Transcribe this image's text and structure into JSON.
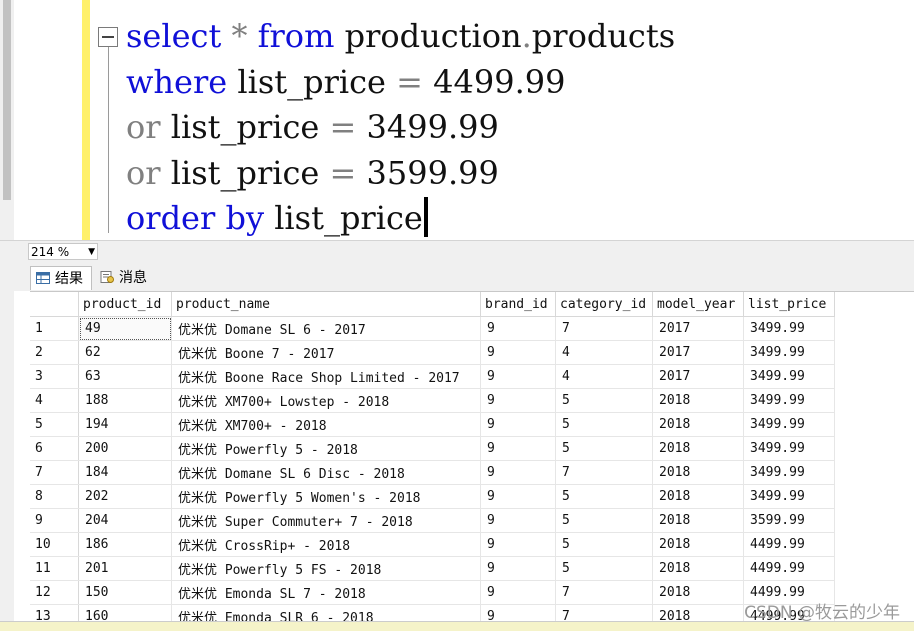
{
  "editor": {
    "lines": [
      {
        "parts": [
          [
            "kw-blue",
            "select"
          ],
          [
            "op-gray",
            " * "
          ],
          [
            "kw-blue",
            "from"
          ],
          [
            "plain",
            " production"
          ],
          [
            "op-gray",
            "."
          ],
          [
            "plain",
            "products"
          ]
        ]
      },
      {
        "parts": [
          [
            "kw-blue",
            "where"
          ],
          [
            "plain",
            " list_price "
          ],
          [
            "op-gray",
            "="
          ],
          [
            "plain",
            " 4499.99"
          ]
        ]
      },
      {
        "parts": [
          [
            "kw-gray",
            "or"
          ],
          [
            "plain",
            " list_price "
          ],
          [
            "op-gray",
            "="
          ],
          [
            "plain",
            " 3499.99"
          ]
        ]
      },
      {
        "parts": [
          [
            "kw-gray",
            "or"
          ],
          [
            "plain",
            " list_price "
          ],
          [
            "op-gray",
            "="
          ],
          [
            "plain",
            " 3599.99"
          ]
        ]
      },
      {
        "parts": [
          [
            "kw-blue",
            "order"
          ],
          [
            "plain",
            " "
          ],
          [
            "kw-blue",
            "by"
          ],
          [
            "plain",
            " list_price"
          ]
        ]
      }
    ]
  },
  "zoom": {
    "value": "214 %"
  },
  "tabs": {
    "results": "结果",
    "messages": "消息"
  },
  "grid": {
    "columns": [
      "product_id",
      "product_name",
      "brand_id",
      "category_id",
      "model_year",
      "list_price"
    ],
    "rows": [
      [
        "1",
        "49",
        "优米优 Domane SL 6 - 2017",
        "9",
        "7",
        "2017",
        "3499.99"
      ],
      [
        "2",
        "62",
        "优米优 Boone 7 - 2017",
        "9",
        "4",
        "2017",
        "3499.99"
      ],
      [
        "3",
        "63",
        "优米优 Boone Race Shop Limited - 2017",
        "9",
        "4",
        "2017",
        "3499.99"
      ],
      [
        "4",
        "188",
        "优米优 XM700+ Lowstep - 2018",
        "9",
        "5",
        "2018",
        "3499.99"
      ],
      [
        "5",
        "194",
        "优米优 XM700+ - 2018",
        "9",
        "5",
        "2018",
        "3499.99"
      ],
      [
        "6",
        "200",
        "优米优 Powerfly 5 - 2018",
        "9",
        "5",
        "2018",
        "3499.99"
      ],
      [
        "7",
        "184",
        "优米优 Domane SL 6 Disc - 2018",
        "9",
        "7",
        "2018",
        "3499.99"
      ],
      [
        "8",
        "202",
        "优米优 Powerfly 5 Women's - 2018",
        "9",
        "5",
        "2018",
        "3499.99"
      ],
      [
        "9",
        "204",
        "优米优 Super Commuter+ 7 - 2018",
        "9",
        "5",
        "2018",
        "3599.99"
      ],
      [
        "10",
        "186",
        "优米优 CrossRip+ - 2018",
        "9",
        "5",
        "2018",
        "4499.99"
      ],
      [
        "11",
        "201",
        "优米优 Powerfly 5 FS - 2018",
        "9",
        "5",
        "2018",
        "4499.99"
      ],
      [
        "12",
        "150",
        "优米优 Emonda SL 7 - 2018",
        "9",
        "7",
        "2018",
        "4499.99"
      ],
      [
        "13",
        "160",
        "优米优 Emonda SLR 6 - 2018",
        "9",
        "7",
        "2018",
        "4499.99"
      ]
    ]
  },
  "watermark": "CSDN @牧云的少年"
}
